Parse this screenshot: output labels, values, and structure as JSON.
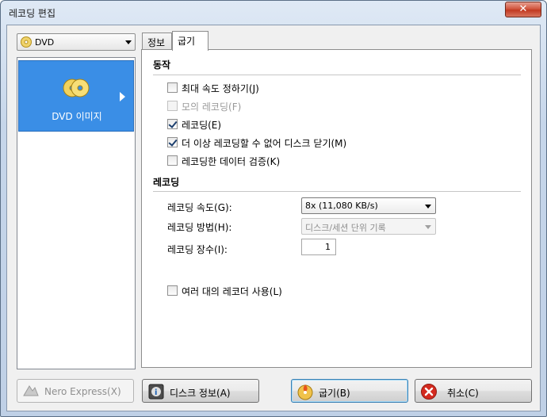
{
  "window": {
    "title": "레코딩 편집",
    "close_label": "✕"
  },
  "drive": {
    "selected": "DVD"
  },
  "categories": [
    {
      "label": "DVD 이미지",
      "selected": true
    }
  ],
  "tabs": [
    {
      "label": "정보"
    },
    {
      "label": "굽기",
      "active": true
    }
  ],
  "sections": {
    "action": {
      "title": "동작",
      "options": [
        {
          "label": "최대 속도 정하기(J)",
          "checked": false,
          "enabled": true
        },
        {
          "label": "모의 레코딩(F)",
          "checked": false,
          "enabled": false
        },
        {
          "label": "레코딩(E)",
          "checked": true,
          "enabled": true
        },
        {
          "label": "더 이상 레코딩할 수 없어 디스크 닫기(M)",
          "checked": true,
          "enabled": true
        },
        {
          "label": "레코딩한 데이터 검증(K)",
          "checked": false,
          "enabled": true
        }
      ]
    },
    "recording": {
      "title": "레코딩",
      "speed_label": "레코딩 속도(G):",
      "speed_value": "8x (11,080 KB/s)",
      "method_label": "레코딩 방법(H):",
      "method_value": "디스크/세션 단위 기록",
      "copies_label": "레코딩 장수(I):",
      "copies_value": "1",
      "multi_recorder": {
        "label": "여러 대의 레코더 사용(L)",
        "checked": false
      }
    }
  },
  "buttons": {
    "nero_express": "Nero Express(X)",
    "disc_info": "디스크 정보(A)",
    "burn": "굽기(B)",
    "cancel": "취소(C)"
  },
  "colors": {
    "selection": "#3a8ee6",
    "cancel_icon": "#d42a1f"
  }
}
